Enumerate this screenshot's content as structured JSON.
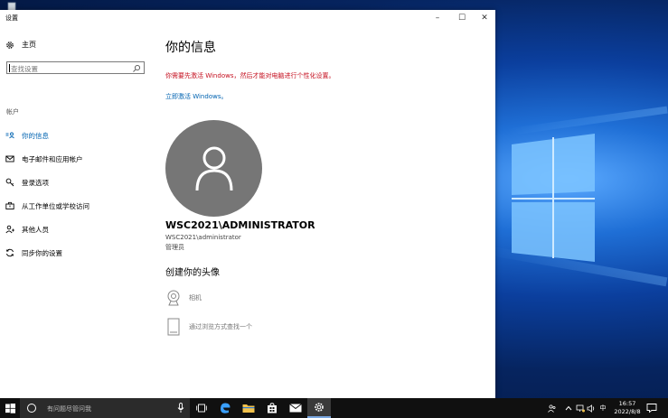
{
  "window": {
    "title": "设置",
    "controls": {
      "minimize": "–",
      "maximize": "☐",
      "close": "✕"
    }
  },
  "sidebar": {
    "home_label": "主页",
    "search_placeholder": "查找设置",
    "section_label": "帐户",
    "items": [
      {
        "label": "你的信息",
        "icon": "person-card-icon",
        "active": true
      },
      {
        "label": "电子邮件和应用帐户",
        "icon": "mail-icon",
        "active": false
      },
      {
        "label": "登录选项",
        "icon": "key-icon",
        "active": false
      },
      {
        "label": "从工作单位或学校访问",
        "icon": "briefcase-icon",
        "active": false
      },
      {
        "label": "其他人员",
        "icon": "people-icon",
        "active": false
      },
      {
        "label": "同步你的设置",
        "icon": "sync-icon",
        "active": false
      }
    ]
  },
  "main": {
    "title": "你的信息",
    "warning": "你需要先激活 Windows，然后才能对电脑进行个性化设置。",
    "activate_link": "立即激活 Windows。",
    "account_name": "WSC2021\\ADMINISTRATOR",
    "account_id": "WSC2021\\administrator",
    "account_role": "管理员",
    "create_avatar_title": "创建你的头像",
    "options": {
      "camera": "相机",
      "browse": "通过浏览方式查找一个"
    }
  },
  "taskbar": {
    "search_placeholder": "有问题尽管问我",
    "ime": "中",
    "time": "16:57",
    "date": "2022/8/8"
  },
  "colors": {
    "accent": "#0063b1",
    "warning": "#c50f1f",
    "avatar_bg": "#767676",
    "taskbar_bg": "#101010"
  }
}
